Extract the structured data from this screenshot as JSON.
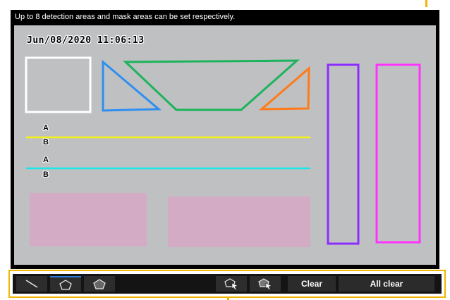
{
  "hint_text": "Up to 8 detection areas and mask areas can be set respectively.",
  "timestamp": "Jun/08/2020 11:06:13",
  "line1": {
    "a_label": "A",
    "b_label": "B",
    "color": "#f2f21a"
  },
  "line2": {
    "a_label": "A",
    "b_label": "B",
    "color": "#1ae8e8"
  },
  "colors": {
    "accent": "#f3b400",
    "selected": "#2b7bd9",
    "square": "#ffffff",
    "triangle_left": "#2f8ff0",
    "trapezoid": "#1db35c",
    "triangle_right": "#ff7a1a",
    "bar_purple": "#8c2cff",
    "bar_magenta": "#ff33ff",
    "mask": "#dba4c6"
  },
  "toolbar": {
    "tools": [
      {
        "name": "line-tool",
        "icon": "line-icon"
      },
      {
        "name": "polygon-outline-tool",
        "icon": "polygon-outline-icon",
        "active": true
      },
      {
        "name": "polygon-filled-tool",
        "icon": "polygon-filled-icon"
      }
    ],
    "select_outline_icon": "polygon-cursor-outline-icon",
    "select_filled_icon": "polygon-cursor-filled-icon",
    "clear_label": "Clear",
    "all_clear_label": "All clear"
  }
}
